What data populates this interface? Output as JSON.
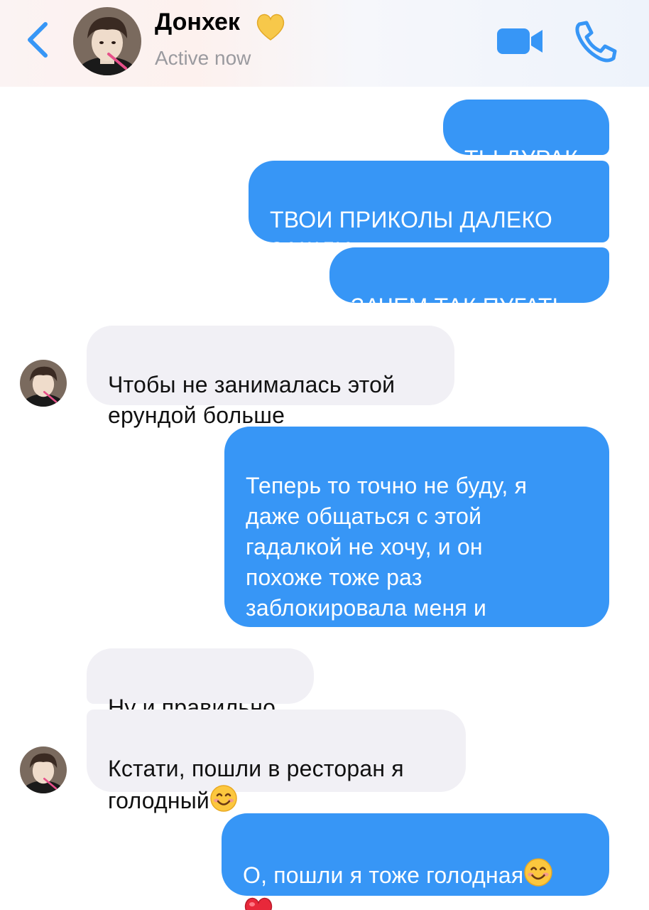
{
  "header": {
    "contact_name": "Донхек",
    "name_emoji": "yellow-heart-icon",
    "status": "Active now",
    "back_icon": "chevron-left-icon",
    "video_icon": "video-camera-icon",
    "phone_icon": "phone-icon",
    "accent_color": "#3796f6"
  },
  "messages": [
    {
      "from": "me",
      "text": "ТЫ ДУРАК"
    },
    {
      "from": "me",
      "text": "ТВОИ ПРИКОЛЫ ДАЛЕКО\nЗАШЛИ"
    },
    {
      "from": "me",
      "text": "ЗАЧЕМ ТАК ПУГАТЬ"
    },
    {
      "from": "contact",
      "text": "Чтобы не занималась этой\nерундой больше"
    },
    {
      "from": "me",
      "text": "Теперь то точно не буду, я\nдаже общаться с этой\nгадалкой не хочу, и он\nпохоже тоже раз\nзаблокировала меня и\nнаписала, что я сама дьявол"
    },
    {
      "from": "contact",
      "text": "Ну и правильно"
    },
    {
      "from": "contact",
      "text": "Кстати, пошли в ресторан я\nголодный",
      "emoji": "smiling-face-icon"
    },
    {
      "from": "me",
      "text": "О, пошли я тоже голодная",
      "emoji": "smiling-face-icon",
      "emoji2": "red-heart-icon"
    }
  ],
  "colors": {
    "outgoing_bubble": "#3796f6",
    "incoming_bubble": "#f1f0f5",
    "status_gray": "#9a9a9f"
  }
}
